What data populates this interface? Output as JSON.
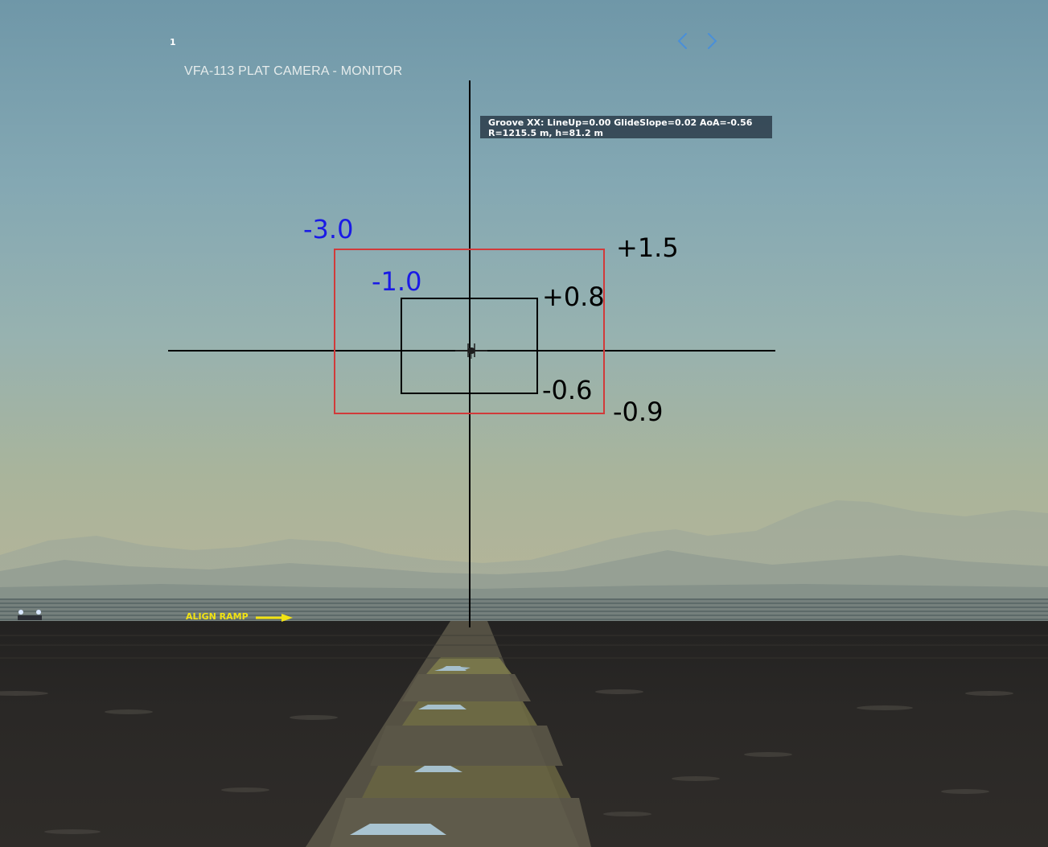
{
  "page_number": "1",
  "camera_title": "VFA-113 PLAT CAMERA - MONITOR",
  "navigation": {
    "prev_icon": "chevron-left-icon",
    "next_icon": "chevron-right-icon",
    "color": "#4a8fd8"
  },
  "info": {
    "line1": "Groove XX: LineUp=0.00  GlideSlope=0.02  AoA=-0.56",
    "line2": "R=1215.5 m, h=81.2 m"
  },
  "outer_box": {
    "left_label": "-3.0",
    "top_label": "+1.5",
    "bottom_label": "-0.9",
    "color": "#d13a3a"
  },
  "inner_box": {
    "left_label": "-1.0",
    "top_label": "+0.8",
    "bottom_label": "-0.6",
    "color": "#000000"
  },
  "deck_callout": {
    "text": "ALIGN RAMP",
    "color": "#f2e313"
  },
  "label_colors": {
    "lateral": "#1a1ae6",
    "vertical": "#000000"
  }
}
